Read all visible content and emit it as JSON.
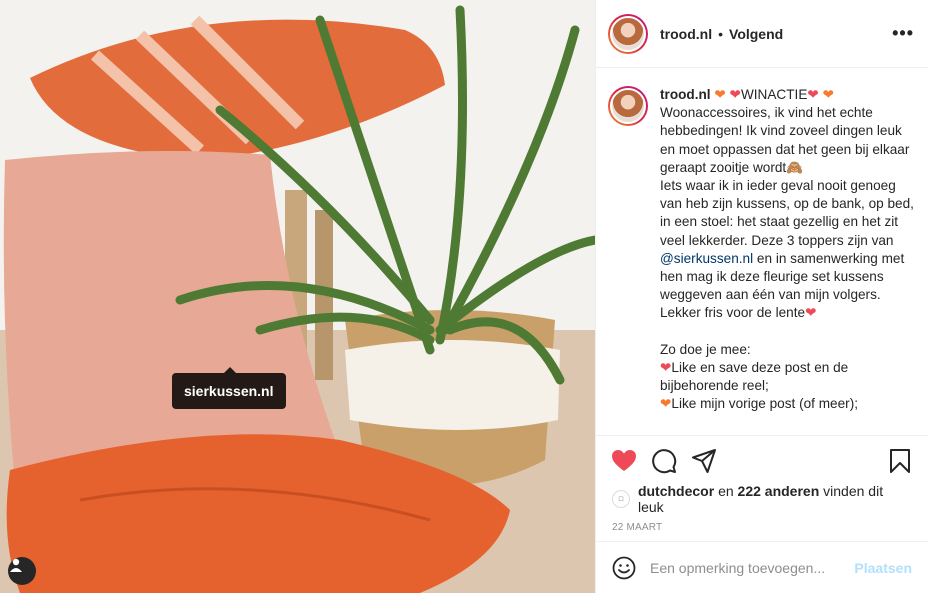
{
  "post": {
    "photo_tag": "sierkussen.nl"
  },
  "header": {
    "username": "trood.nl",
    "separator": "•",
    "follow_label": "Volgend",
    "more_label": "•••"
  },
  "caption": {
    "username": "trood.nl",
    "winactie": "WINACTIE",
    "line1": "Woonaccessoires, ik vind het echte hebbedingen! Ik vind zoveel dingen leuk en moet oppassen dat het geen bij elkaar geraapt zooitje wordt",
    "line2": "Iets waar ik in ieder geval nooit genoeg van heb zijn kussens, op de bank, op bed, in een stoel: het staat gezellig en het zit veel lekkerder. Deze 3 toppers zijn van ",
    "mention": "@sierkussen.nl",
    "line3": " en in samenwerking met hen mag ik deze fleurige set kussens weggeven aan één van mijn volgers. Lekker fris voor de lente",
    "howto": "Zo doe je mee:",
    "step1": "Like en save deze post en de bijbehorende reel;",
    "step2": "Like mijn vorige post (of meer);"
  },
  "likes": {
    "first_user": "dutchdecor",
    "connector": "en",
    "others": "222 anderen",
    "suffix": "vinden dit leuk"
  },
  "date": "22 MAART",
  "comment": {
    "placeholder": "Een opmerking toevoegen...",
    "post_label": "Plaatsen"
  },
  "colors": {
    "like_red": "#ed4956",
    "orange_heart": "#f77b2e",
    "mention_blue": "#00376b",
    "post_disabled": "#b2dffc"
  }
}
